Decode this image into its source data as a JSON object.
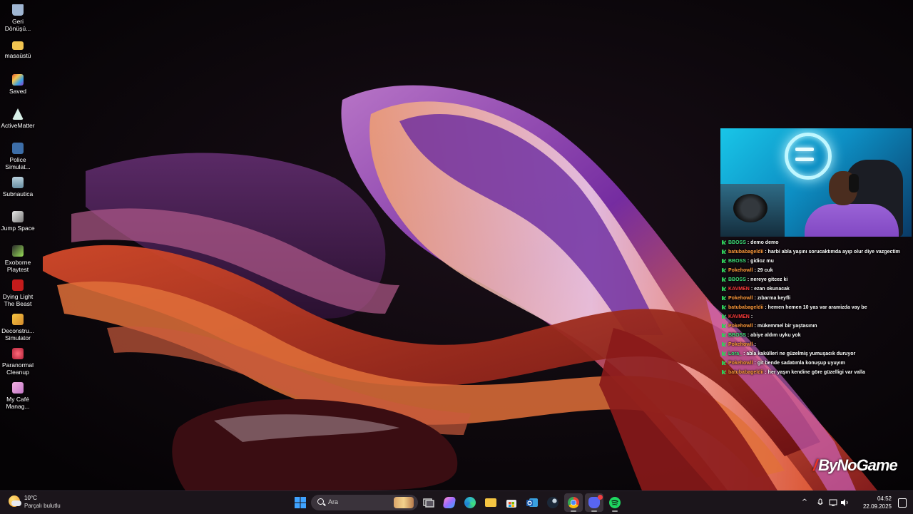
{
  "desktop": {
    "icons": [
      {
        "label": "Geri\nDönüşü...",
        "icon": "recycle-bin-icon",
        "color": "#9fb6d2"
      },
      {
        "label": "masaüstü",
        "icon": "folder-icon",
        "color": "#f2c550"
      },
      {
        "label": "Saved",
        "icon": "app-icon",
        "color": "#e0562f"
      },
      {
        "label": "ActiveMatter",
        "icon": "app-icon",
        "color": "#d8f0e8"
      },
      {
        "label": "Police\nSimulat...",
        "icon": "app-icon",
        "color": "#3d6ea8"
      },
      {
        "label": "Subnautica",
        "icon": "app-icon",
        "color": "#6a8fa3"
      },
      {
        "label": "Jump Space",
        "icon": "app-icon",
        "color": "#c5c5c5"
      },
      {
        "label": "Exoborne\nPlaytest",
        "icon": "app-icon",
        "color": "#4a4a4a"
      },
      {
        "label": "Dying Light\nThe Beast",
        "icon": "app-icon",
        "color": "#c41b1b"
      },
      {
        "label": "Deconstru...\nSimulator",
        "icon": "app-icon",
        "color": "#d48a2c"
      },
      {
        "label": "Paranormal\nCleanup",
        "icon": "app-icon",
        "color": "#b3243a"
      },
      {
        "label": "My Café\nManag...",
        "icon": "app-icon",
        "color": "#c679c9"
      }
    ]
  },
  "chat": {
    "messages": [
      {
        "user": "BBOSS",
        "color": "#3fe07a",
        "text": ": demo demo"
      },
      {
        "user": "batubabageldii",
        "color": "#ff9a3c",
        "text": ": harbi abla yaşını sorucaktımda ayıp olur diye vazgectim"
      },
      {
        "user": "BBOSS",
        "color": "#3fe07a",
        "text": ": gidioz mu"
      },
      {
        "user": "Pokehowll",
        "color": "#ff9a3c",
        "text": ": 29 cuk"
      },
      {
        "user": "BBOSS",
        "color": "#3fe07a",
        "text": ": nereye gitcez ki"
      },
      {
        "user": "KAVMEN",
        "color": "#ff3c3c",
        "text": ": ezan okunacak"
      },
      {
        "user": "Pokehowll",
        "color": "#ff9a3c",
        "text": ": zıbarma keyfli"
      },
      {
        "user": "batubabageldii",
        "color": "#ff9a3c",
        "text": ": hemen hemen 10 yas var aramizda vay be"
      },
      {
        "user": "KAVMEN",
        "color": "#ff3c3c",
        "text": ":"
      },
      {
        "user": "Pokehowll",
        "color": "#ff9a3c",
        "text": ": mükemmel bir yaştasının"
      },
      {
        "user": "BBOSS",
        "color": "#3fe07a",
        "text": ": abiye aldım uyku yok"
      },
      {
        "user": "Pokehowll",
        "color": "#ff9a3c",
        "text": ":"
      },
      {
        "user": "Lora_",
        "color": "#3fe07a",
        "text": ": abla kakülleri ne güzelmiş yumuşacık duruyor"
      },
      {
        "user": "Pokehowll",
        "color": "#ff9a3c",
        "text": ": git bende sadatımla konuşup uyuyım"
      },
      {
        "user": "batubabageldii",
        "color": "#ff9a3c",
        "text": ": her yaşın kendine göre güzelligi var valla"
      }
    ]
  },
  "brand": {
    "name": "ByNoGame"
  },
  "taskbar": {
    "weather": {
      "temp": "10°C",
      "condition": "Parçalı bulutlu"
    },
    "search_placeholder": "Ara",
    "apps": [
      {
        "name": "start-button",
        "color": "#3fa3ff"
      },
      {
        "name": "task-view-button",
        "color": "#d0d0d0"
      },
      {
        "name": "copilot-button",
        "color": "#9a6bff"
      },
      {
        "name": "edge-button",
        "color": "#2fb8c8"
      },
      {
        "name": "file-explorer-button",
        "color": "#f5c542"
      },
      {
        "name": "store-button",
        "color": "#e8e8e8"
      },
      {
        "name": "outlook-button",
        "color": "#1e7fd6"
      },
      {
        "name": "steam-button",
        "color": "#c6d4df"
      },
      {
        "name": "chrome-button",
        "color": "#3fb24a"
      },
      {
        "name": "discord-button",
        "color": "#5865f2"
      },
      {
        "name": "spotify-button",
        "color": "#1ed760"
      }
    ],
    "clock": {
      "time": "04:52",
      "date": "22.09.2025"
    }
  }
}
